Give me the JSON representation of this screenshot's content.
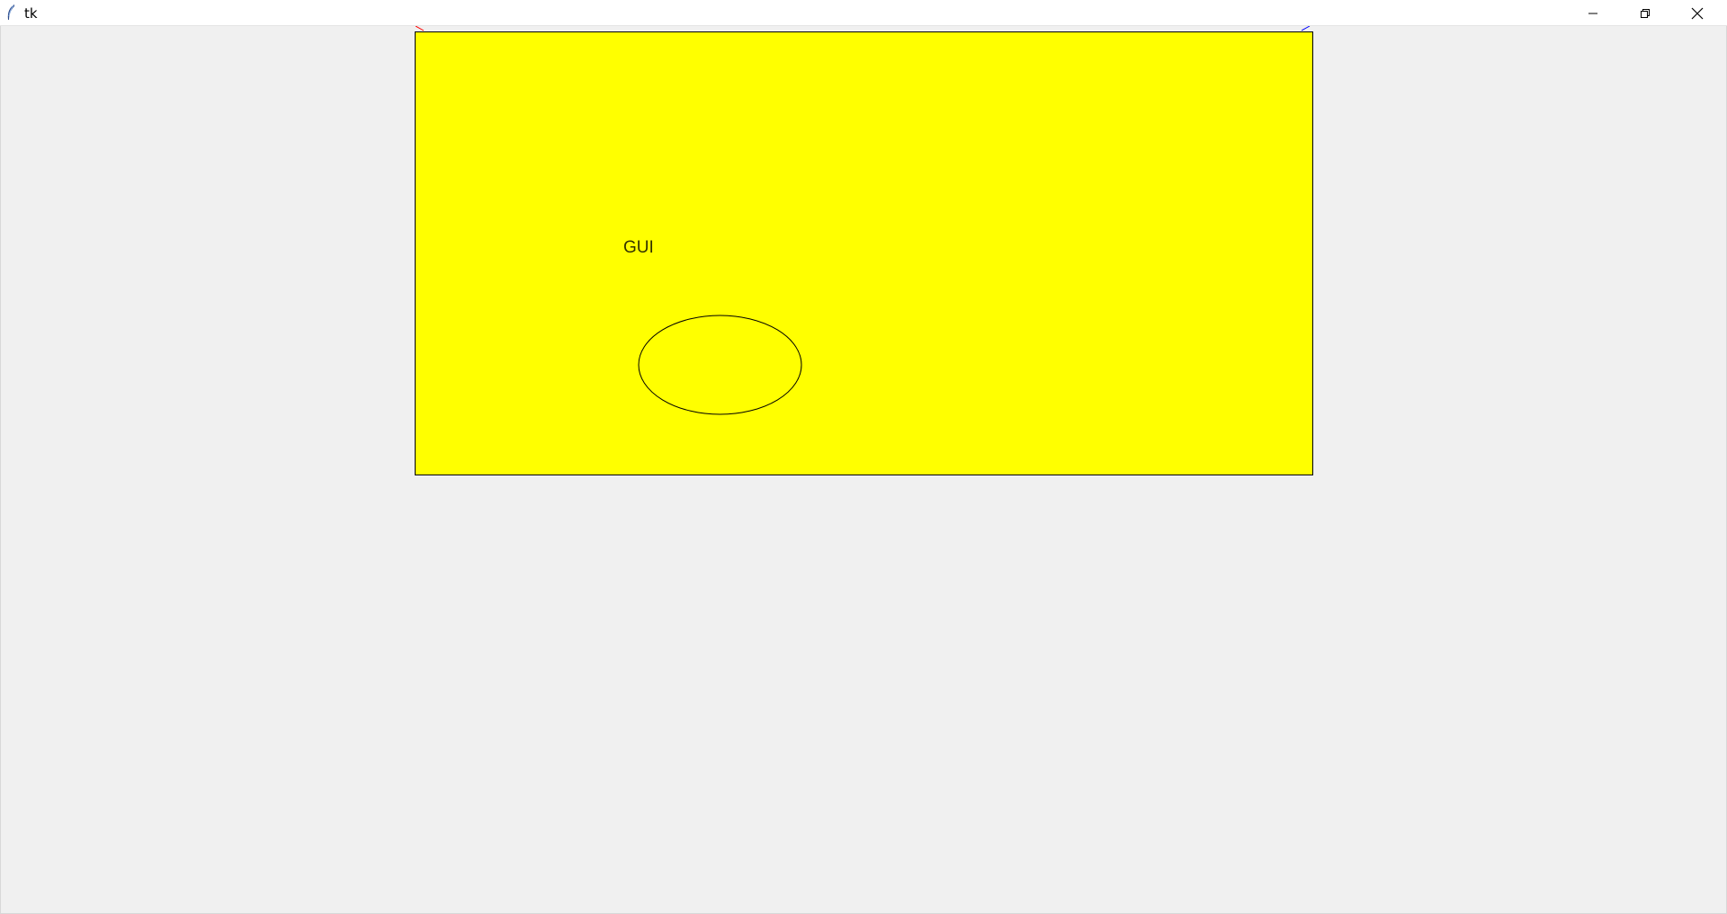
{
  "window": {
    "title": "tk",
    "icon": "tk-feather-icon",
    "controls": {
      "minimize_icon": "minimize-icon",
      "maximize_icon": "restore-icon",
      "close_icon": "close-icon"
    }
  },
  "canvas": {
    "background": "#ffff00",
    "outline": "#000000",
    "text": "GUI",
    "oval_outline": "#000000",
    "oval_fill": "#ffff00"
  },
  "colors": {
    "window_bg": "#f0f0f0",
    "titlebar_bg": "#ffffff",
    "stray_line_left": "#ff0000",
    "stray_line_right": "#0000ff"
  }
}
